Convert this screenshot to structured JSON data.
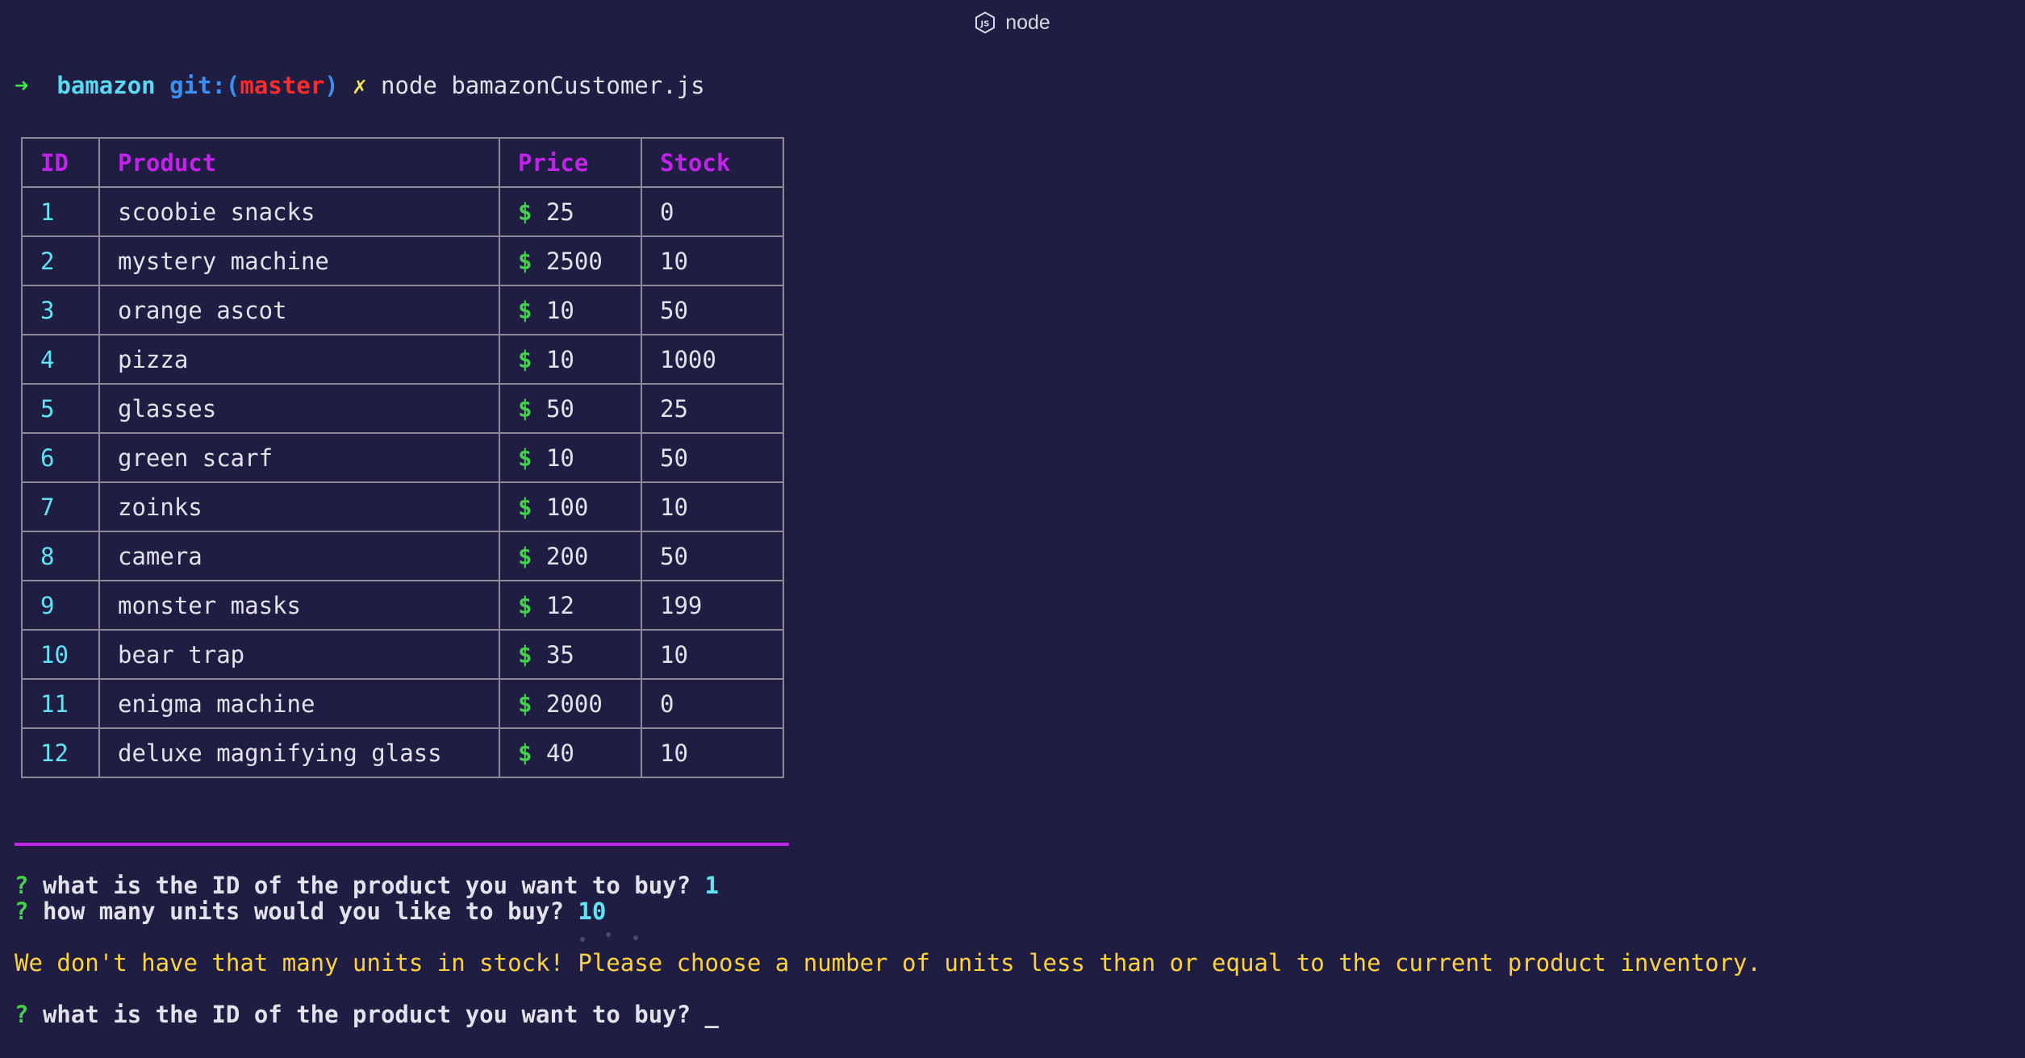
{
  "window": {
    "title": "node",
    "icon": "nodejs-icon"
  },
  "prompt": {
    "arrow": "➜",
    "directory": "bamazon",
    "git_prefix": "git:(",
    "branch": "master",
    "git_suffix": ")",
    "dirty_mark": "✗",
    "command": "node bamazonCustomer.js"
  },
  "table": {
    "headers": [
      "ID",
      "Product",
      "Price",
      "Stock"
    ],
    "currency_symbol": "$",
    "rows": [
      {
        "id": "1",
        "product": "scoobie snacks",
        "price": "25",
        "stock": "0"
      },
      {
        "id": "2",
        "product": "mystery machine",
        "price": "2500",
        "stock": "10"
      },
      {
        "id": "3",
        "product": "orange ascot",
        "price": "10",
        "stock": "50"
      },
      {
        "id": "4",
        "product": "pizza",
        "price": "10",
        "stock": "1000"
      },
      {
        "id": "5",
        "product": "glasses",
        "price": "50",
        "stock": "25"
      },
      {
        "id": "6",
        "product": "green scarf",
        "price": "10",
        "stock": "50"
      },
      {
        "id": "7",
        "product": "zoinks",
        "price": "100",
        "stock": "10"
      },
      {
        "id": "8",
        "product": "camera",
        "price": "200",
        "stock": "50"
      },
      {
        "id": "9",
        "product": "monster masks",
        "price": "12",
        "stock": "199"
      },
      {
        "id": "10",
        "product": "bear trap",
        "price": "35",
        "stock": "10"
      },
      {
        "id": "11",
        "product": "enigma machine",
        "price": "2000",
        "stock": "0"
      },
      {
        "id": "12",
        "product": "deluxe magnifying glass",
        "price": "40",
        "stock": "10"
      }
    ]
  },
  "dialog": {
    "question_mark": "?",
    "q1": "what is the ID of the product you want to buy?",
    "a1": "1",
    "q2": "how many units would you like to buy?",
    "a2": "10",
    "warning": "We don't have that many units in stock! Please choose a number of units less than or equal to the current product inventory.",
    "q3": "what is the ID of the product you want to buy?",
    "cursor": "_"
  },
  "colors": {
    "background": "#1f1d42",
    "header_magenta": "#c322e8",
    "id_cyan": "#61e3f4",
    "dollar_green": "#44d04c",
    "warning_yellow": "#ffd33d",
    "branch_red": "#ff2a2a"
  }
}
